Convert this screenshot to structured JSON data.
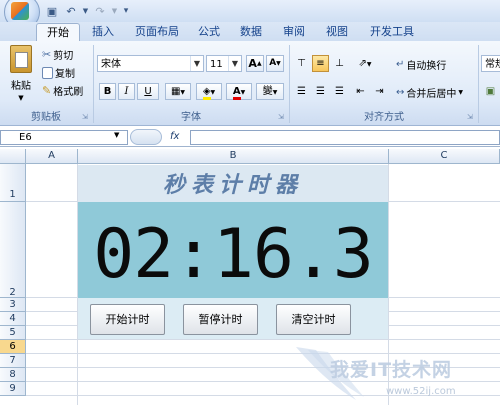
{
  "tabs": [
    "开始",
    "插入",
    "页面布局",
    "公式",
    "数据",
    "审阅",
    "视图",
    "开发工具"
  ],
  "clipboard": {
    "paste": "粘贴",
    "cut": "剪切",
    "copy": "复制",
    "format_painter": "格式刷",
    "label": "剪贴板"
  },
  "font": {
    "name": "宋体",
    "size": "11",
    "bold": "B",
    "italic": "I",
    "underline": "U",
    "color_a": "A",
    "wen": "變",
    "grow": "A",
    "shrink": "A",
    "label": "字体"
  },
  "alignment": {
    "wrap_text": "自动换行",
    "merge_center": "合并后居中",
    "label": "对齐方式"
  },
  "number": {
    "format": "常规"
  },
  "formula_bar": {
    "name_box": "E6",
    "fx": "fx",
    "content": ""
  },
  "columns": [
    "A",
    "B",
    "C"
  ],
  "rows": [
    "1",
    "2",
    "3",
    "4",
    "5",
    "6",
    "7",
    "8",
    "9"
  ],
  "selected_row": "6",
  "stopwatch": {
    "title": "秒表计时器",
    "time": "02:16.3",
    "buttons": {
      "start": "开始计时",
      "pause": "暂停计时",
      "clear": "清空计时"
    }
  },
  "watermark": {
    "text": "我爱IT技术网",
    "url": "www.52ij.com"
  },
  "colors": {
    "display_bg": "#8fc9d8",
    "title_color": "#5d7ea8",
    "header_select": "#f8d88e"
  }
}
